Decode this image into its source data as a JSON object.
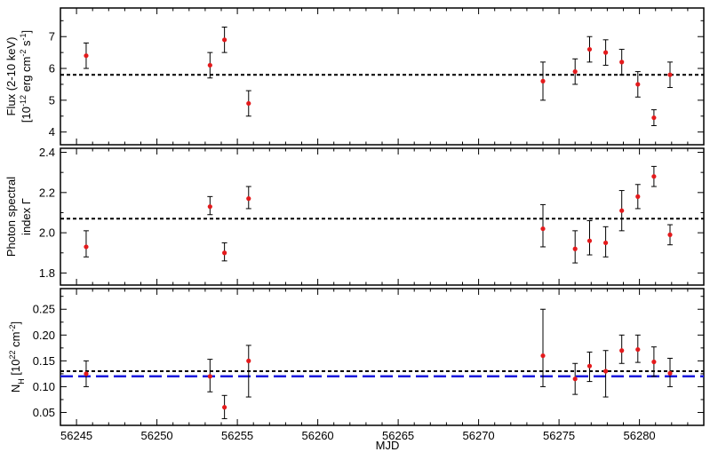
{
  "chart_data": {
    "type": "scatter",
    "xlabel": "MJD",
    "xlim": [
      56244,
      56284
    ],
    "xticks": [
      56245,
      56250,
      56255,
      56260,
      56265,
      56270,
      56275,
      56280
    ],
    "grid": false,
    "panels": [
      {
        "ylabel_lines": [
          {
            "parts": [
              {
                "t": "Flux (2-10 keV)"
              }
            ]
          },
          {
            "parts": [
              {
                "t": "[10"
              },
              {
                "t": "-12",
                "sup": true
              },
              {
                "t": " erg cm"
              },
              {
                "t": "-2",
                "sup": true
              },
              {
                "t": " s"
              },
              {
                "t": "-1",
                "sup": true
              },
              {
                "t": "]"
              }
            ]
          }
        ],
        "ylim": [
          3.6,
          7.9
        ],
        "yticks": [
          4,
          5,
          6,
          7
        ],
        "yticklabels": [
          "4",
          "5",
          "6",
          "7"
        ],
        "reference_lines": [
          {
            "y": 5.8,
            "style": "dotted",
            "color": "#000000"
          }
        ],
        "points": [
          {
            "x": 56245.6,
            "y": 6.4,
            "ylo": 6.0,
            "yhi": 6.8
          },
          {
            "x": 56253.3,
            "y": 6.1,
            "ylo": 5.7,
            "yhi": 6.5
          },
          {
            "x": 56254.2,
            "y": 6.9,
            "ylo": 6.5,
            "yhi": 7.3
          },
          {
            "x": 56255.7,
            "y": 4.9,
            "ylo": 4.5,
            "yhi": 5.3
          },
          {
            "x": 56274.0,
            "y": 5.6,
            "ylo": 5.0,
            "yhi": 6.2
          },
          {
            "x": 56276.0,
            "y": 5.9,
            "ylo": 5.5,
            "yhi": 6.3
          },
          {
            "x": 56276.9,
            "y": 6.6,
            "ylo": 6.2,
            "yhi": 7.0
          },
          {
            "x": 56277.9,
            "y": 6.5,
            "ylo": 6.1,
            "yhi": 6.9
          },
          {
            "x": 56278.9,
            "y": 6.2,
            "ylo": 5.8,
            "yhi": 6.6
          },
          {
            "x": 56279.9,
            "y": 5.5,
            "ylo": 5.1,
            "yhi": 5.9
          },
          {
            "x": 56280.9,
            "y": 4.45,
            "ylo": 4.2,
            "yhi": 4.7
          },
          {
            "x": 56281.9,
            "y": 5.8,
            "ylo": 5.4,
            "yhi": 6.2
          }
        ]
      },
      {
        "ylabel_lines": [
          {
            "parts": [
              {
                "t": "Photon spectral"
              }
            ]
          },
          {
            "parts": [
              {
                "t": "index Γ"
              }
            ]
          }
        ],
        "ylim": [
          1.74,
          2.42
        ],
        "yticks": [
          1.8,
          2.0,
          2.2,
          2.4
        ],
        "yticklabels": [
          "1.8",
          "2.0",
          "2.2",
          "2.4"
        ],
        "reference_lines": [
          {
            "y": 2.07,
            "style": "dotted",
            "color": "#000000"
          }
        ],
        "points": [
          {
            "x": 56245.6,
            "y": 1.93,
            "ylo": 1.88,
            "yhi": 2.01
          },
          {
            "x": 56253.3,
            "y": 2.13,
            "ylo": 2.09,
            "yhi": 2.18
          },
          {
            "x": 56254.2,
            "y": 1.9,
            "ylo": 1.86,
            "yhi": 1.95
          },
          {
            "x": 56255.7,
            "y": 2.17,
            "ylo": 2.12,
            "yhi": 2.23
          },
          {
            "x": 56274.0,
            "y": 2.02,
            "ylo": 1.93,
            "yhi": 2.14
          },
          {
            "x": 56276.0,
            "y": 1.92,
            "ylo": 1.85,
            "yhi": 2.01
          },
          {
            "x": 56276.9,
            "y": 1.96,
            "ylo": 1.89,
            "yhi": 2.06
          },
          {
            "x": 56277.9,
            "y": 1.95,
            "ylo": 1.88,
            "yhi": 2.03
          },
          {
            "x": 56278.9,
            "y": 2.11,
            "ylo": 2.01,
            "yhi": 2.21
          },
          {
            "x": 56279.9,
            "y": 2.18,
            "ylo": 2.12,
            "yhi": 2.24
          },
          {
            "x": 56280.9,
            "y": 2.28,
            "ylo": 2.23,
            "yhi": 2.33
          },
          {
            "x": 56281.9,
            "y": 1.99,
            "ylo": 1.94,
            "yhi": 2.04
          }
        ]
      },
      {
        "ylabel_lines": [
          {
            "parts": [
              {
                "t": "N"
              },
              {
                "t": "H",
                "sub": true
              },
              {
                "t": " [10"
              },
              {
                "t": "22",
                "sup": true
              },
              {
                "t": " cm"
              },
              {
                "t": "-2",
                "sup": true
              },
              {
                "t": "]"
              }
            ]
          }
        ],
        "ylim": [
          0.025,
          0.29
        ],
        "yticks": [
          0.05,
          0.1,
          0.15,
          0.2,
          0.25
        ],
        "yticklabels": [
          "0.05",
          "0.10",
          "0.15",
          "0.20",
          "0.25"
        ],
        "reference_lines": [
          {
            "y": 0.13,
            "style": "dotted",
            "color": "#000000"
          },
          {
            "y": 0.12,
            "style": "dashed",
            "color": "#1a1adc"
          }
        ],
        "points": [
          {
            "x": 56245.6,
            "y": 0.125,
            "ylo": 0.1,
            "yhi": 0.15
          },
          {
            "x": 56253.3,
            "y": 0.12,
            "ylo": 0.09,
            "yhi": 0.153
          },
          {
            "x": 56254.2,
            "y": 0.06,
            "ylo": 0.038,
            "yhi": 0.083
          },
          {
            "x": 56255.7,
            "y": 0.15,
            "ylo": 0.08,
            "yhi": 0.18
          },
          {
            "x": 56274.0,
            "y": 0.16,
            "ylo": 0.1,
            "yhi": 0.25
          },
          {
            "x": 56276.0,
            "y": 0.115,
            "ylo": 0.085,
            "yhi": 0.145
          },
          {
            "x": 56276.9,
            "y": 0.14,
            "ylo": 0.11,
            "yhi": 0.167
          },
          {
            "x": 56277.9,
            "y": 0.13,
            "ylo": 0.08,
            "yhi": 0.17
          },
          {
            "x": 56278.9,
            "y": 0.17,
            "ylo": 0.145,
            "yhi": 0.2
          },
          {
            "x": 56279.9,
            "y": 0.172,
            "ylo": 0.147,
            "yhi": 0.2
          },
          {
            "x": 56280.9,
            "y": 0.148,
            "ylo": 0.12,
            "yhi": 0.177
          },
          {
            "x": 56281.9,
            "y": 0.126,
            "ylo": 0.1,
            "yhi": 0.155
          }
        ]
      }
    ],
    "colors": {
      "points": "#e41a1c",
      "errorbars": "#000000",
      "frame": "#000000"
    }
  }
}
